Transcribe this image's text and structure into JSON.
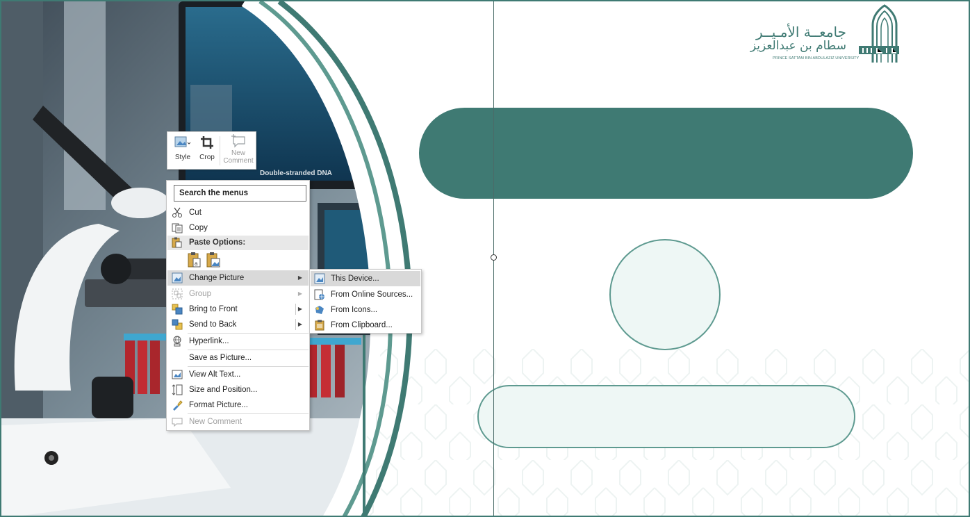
{
  "slide": {
    "accent_color": "#3f7a73",
    "light_fill": "#eef7f5"
  },
  "logo": {
    "arabic_line1": "جامعــة الأمـيــر",
    "arabic_line2": "سطام بن عبدالعزيز",
    "english": "PRINCE SATTAM BIN ABDULAZIZ UNIVERSITY"
  },
  "photo": {
    "screen_caption": "Double-stranded DNA"
  },
  "mini_toolbar": {
    "style_label": "Style",
    "crop_label": "Crop",
    "new_comment_label_1": "New",
    "new_comment_label_2": "Comment"
  },
  "context_menu": {
    "search_placeholder": "Search the menus",
    "cut": "Cut",
    "copy": "Copy",
    "paste_options": "Paste Options:",
    "change_picture": "Change Picture",
    "group": "Group",
    "bring_to_front": "Bring to Front",
    "send_to_back": "Send to Back",
    "hyperlink": "Hyperlink...",
    "save_as_picture": "Save as Picture...",
    "view_alt_text": "View Alt Text...",
    "size_and_position": "Size and Position...",
    "format_picture": "Format Picture...",
    "new_comment": "New Comment"
  },
  "sub_menu": {
    "this_device": "This Device...",
    "from_online_sources": "From Online Sources...",
    "from_icons": "From Icons...",
    "from_clipboard": "From Clipboard..."
  },
  "icons": [
    "style-icon",
    "crop-icon",
    "new-comment-icon",
    "scissors-icon",
    "copy-icon",
    "paste-icon",
    "change-picture-icon",
    "group-icon",
    "bring-to-front-icon",
    "send-to-back-icon",
    "hyperlink-icon",
    "alt-text-icon",
    "size-position-icon",
    "format-picture-icon",
    "comment-icon",
    "device-icon",
    "online-icon",
    "icons-icon",
    "clipboard-icon"
  ]
}
